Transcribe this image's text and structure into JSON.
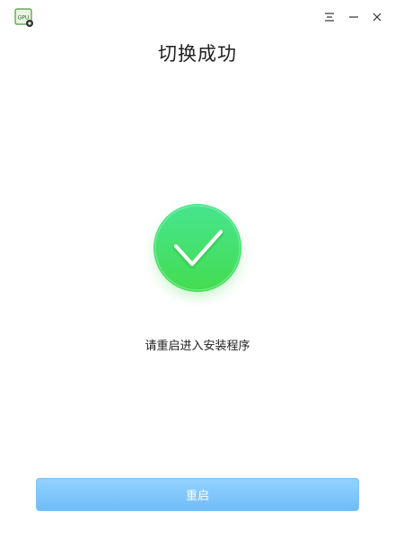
{
  "window": {
    "app_icon": "gpu-icon",
    "app_icon_text": "GPU",
    "controls": [
      "menu-icon",
      "minimize-icon",
      "close-icon"
    ]
  },
  "page": {
    "title": "切换成功",
    "status_icon": "check-circle-icon",
    "message": "请重启进入安装程序"
  },
  "actions": {
    "restart_label": "重启"
  },
  "colors": {
    "success_green": "#3fdc5a",
    "button_blue": "#7cc4fa",
    "text": "#1f1f1f"
  }
}
